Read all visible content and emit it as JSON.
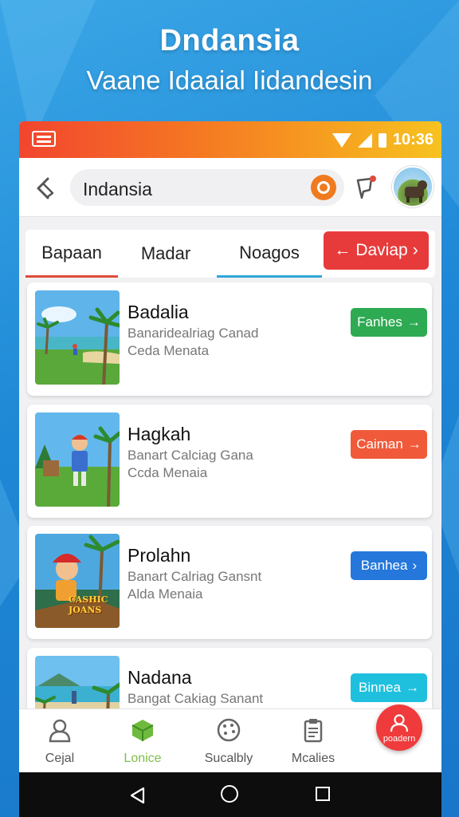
{
  "hero": {
    "title": "Dndansia",
    "subtitle": "Vaane Idaaial Iidandesin"
  },
  "status_bar": {
    "time": "10:36",
    "icons": [
      "app-icon",
      "wifi-icon",
      "signal-icon",
      "battery-icon"
    ],
    "gradient": [
      "#f2452f",
      "#f57b22",
      "#f7c21f"
    ]
  },
  "app_bar": {
    "back_icon": "back-icon",
    "search": {
      "value": "Indansia",
      "icon": "search-icon"
    },
    "pin_icon": "pin-icon",
    "avatar_icon": "avatar"
  },
  "tabs": [
    {
      "label": "Bapaan",
      "active": true
    },
    {
      "label": "Madar",
      "active": false
    },
    {
      "label": "Noagos",
      "active": true
    }
  ],
  "tab_button": {
    "label": "Daviap",
    "color": "#e73b3b"
  },
  "cards": [
    {
      "title": "Badalia",
      "line1": "Banaridealriag Canad",
      "line2": "Ceda Menata",
      "button": "Fanhes",
      "button_color": "#2eaa52"
    },
    {
      "title": "Hagkah",
      "line1": "Banart Calciag Gana",
      "line2": "Ccda Menaia",
      "button": "Caiman",
      "button_color": "#f05a3a"
    },
    {
      "title": "Prolahn",
      "line1": "Banart Calriag Gansnt",
      "line2": "Alda Menaia",
      "button": "Banhea",
      "button_color": "#2577db"
    },
    {
      "title": "Nadana",
      "line1": "Bangat Cakiag Sanant",
      "line2": "",
      "button": "Binnea",
      "button_color": "#1fc0de"
    }
  ],
  "thumb_text": "CASHIC JOANS",
  "bottom_nav": [
    {
      "label": "Cejal",
      "icon": "home-icon",
      "color": "#555555"
    },
    {
      "label": "Lonice",
      "icon": "cube-icon",
      "color": "#7fbf4a"
    },
    {
      "label": "Sucalbly",
      "icon": "palette-icon",
      "color": "#555555"
    },
    {
      "label": "Mcalies",
      "icon": "clipboard-icon",
      "color": "#555555"
    }
  ],
  "bottom_fab": {
    "label": "poadern",
    "icon": "user-icon",
    "color": "#ef3b3b"
  },
  "system_nav": [
    "back-icon",
    "home-icon",
    "recents-icon"
  ]
}
